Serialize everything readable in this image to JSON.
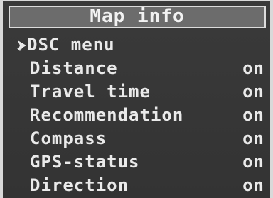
{
  "title": "Map info",
  "menu": {
    "items": [
      {
        "label": "DSC menu",
        "value": "",
        "selected": true,
        "icon": "arrow-cursor-icon"
      },
      {
        "label": "Distance",
        "value": "on"
      },
      {
        "label": "Travel time",
        "value": "on"
      },
      {
        "label": "Recommendation",
        "value": "on"
      },
      {
        "label": "Compass",
        "value": "on"
      },
      {
        "label": "GPS-status",
        "value": "on"
      },
      {
        "label": "Direction",
        "value": "on"
      }
    ]
  }
}
